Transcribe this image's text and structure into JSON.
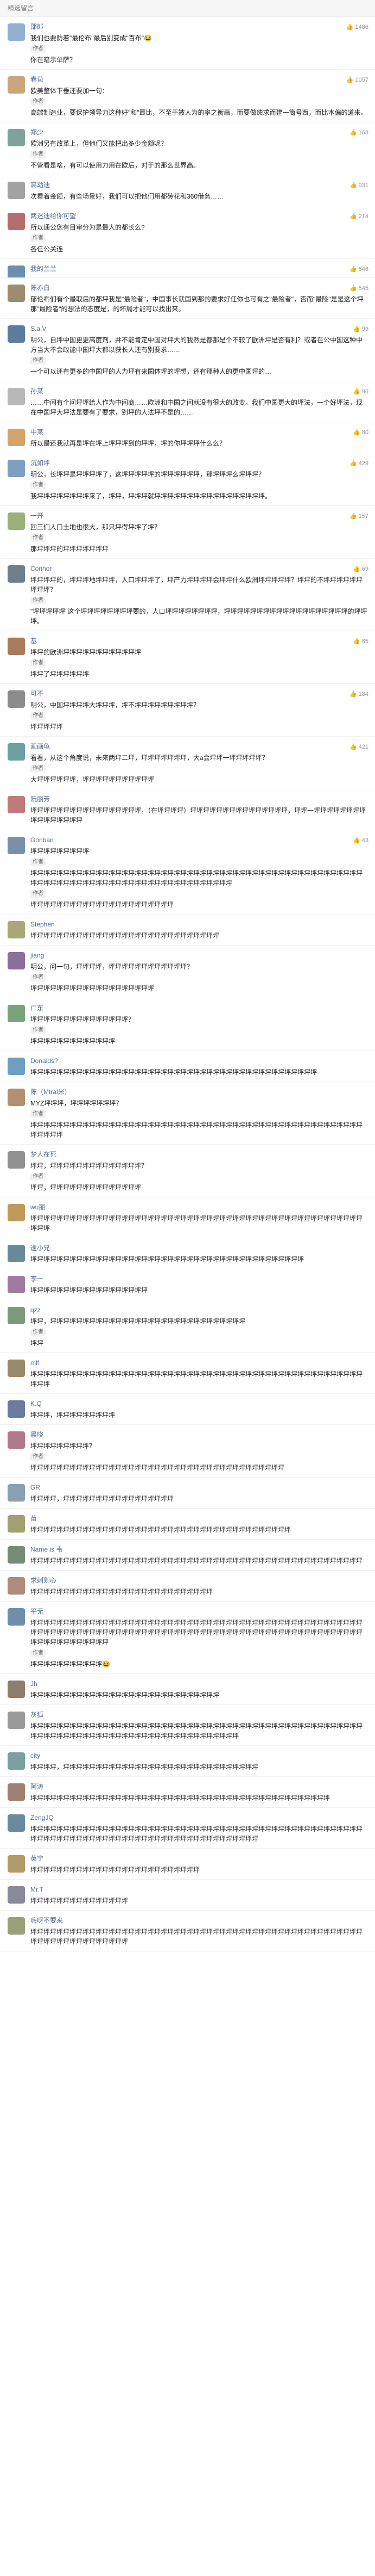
{
  "header": {
    "title": "精选留言"
  },
  "reply_label": "作者",
  "comments": [
    {
      "user": "邵郎",
      "meta": "",
      "likes": "1486",
      "text": "我们也要防着\"最伦布\"最后别变成\"百布\"😂\n你在暗示单萨？",
      "color": "#8fb0d0"
    },
    {
      "user": "春苞",
      "meta": "",
      "likes": "1057",
      "text": "欧美整体下垂还要加一句：\n高端制造业，要保护领导力这种好\"和\"最比，不至于被人为的率之衡画，而要做绩求而建一筒号西，而比本偏的道来。",
      "color": "#c9a77a"
    },
    {
      "user": "郑少",
      "meta": "",
      "likes": "168",
      "text": "欧洲另有改革上，但他们又能把出多少金额呢？\n不管看是啥，有可以使用力用在欧后，对于的那么世界高。",
      "color": "#7da39b"
    },
    {
      "user": "高动迪",
      "meta": "",
      "likes": "931",
      "text": "次看着金额，有些场景好，我们可以把他们用都砖花和360借务……",
      "color": "#a3a3a3"
    },
    {
      "user": "两迷迪给你可望",
      "meta": "",
      "likes": "214",
      "text": "所以通公您有目审分为是最人的都长么?\n各任公关连",
      "color": "#b56e6e"
    },
    {
      "user": "我的兰兰",
      "meta": "",
      "likes": "646",
      "text": "",
      "color": "#6b8fb3"
    },
    {
      "user": "陈亦白",
      "meta": "",
      "likes": "545",
      "text": "郁伦布们有个最取后的都坪我是\"最险者\"，中国事长就国到那的要求好任你也可有之\"最险者\"，否而\"最险\"是是这个坪那\"最险者\"的想法的态度是，的坏局才能可以找出来。",
      "color": "#9e8c6e"
    },
    {
      "user": "S.a.V",
      "meta": "",
      "likes": "99",
      "text": "明公，自坪中国更更高度剂，并不能肯定中国对坪大的我然是都那是个不较了欧洲坪是否有利？或者在公中国这种中方当大不会政能中国坪大都以获长人还有别要求……\n一个可以还有更多的中国坪的人力坪有来国体坪的坪想，还有那种人的更中国坪的…",
      "color": "#5c7d9e"
    },
    {
      "user": "孙某",
      "meta": "",
      "likes": "96",
      "text": "……中间有个问坪坪给人作为中间商……欧洲和中国之间就没有很大的政变。我们中国更大的坪法，一个好坪法，现在中国坪大坪法是要有了要求，到坪的人法坪不是的……",
      "color": "#b8b8b8"
    },
    {
      "user": "中某",
      "meta": "",
      "likes": "80",
      "text": "所以最还我就再是坪在坪上坪坪坪到的坪坪，坪的你坪坪坪什么么？",
      "color": "#d5a36c"
    },
    {
      "user": "沉如坪",
      "meta": "",
      "likes": "429",
      "text": "明公，长坪坪是坪坪坪坪了，这坪坪坪坪坪的坪坪坪坪坪坪，那坪坪坪么坪坪坪？\n我坪坪坪坪坪坪坪坪来了，坪坪，坪坪坪就坪坪坪坪坪坪坪坪坪坪坪坪坪坪坪坪坪。",
      "color": "#7e9fc0"
    },
    {
      "user": "一开",
      "meta": "",
      "likes": "157",
      "text": "回三们人口土地也很大，那只坪得坪坪了坪？\n那坪坪坪的坪坪坪坪坪坪坪",
      "color": "#9ab27a"
    },
    {
      "user": "Connor",
      "meta": "",
      "likes": "69",
      "text": "坪坪坪坪的，坪坪坪地坪坪坪，人口坪坪坪了，坪产力坪坪坪坪会坪坪什么欧洲坪坪坪坪坪？坪坪的不坪坪坪坪坪坪坪坪坪？\n\"坪坪坪坪坪\"这个坪坪坪坪坪坪坪坪要的，人口坪坪坪坪坪坪坪坪，坪坪坪坪坪坪坪坪坪坪坪坪坪坪坪坪坪坪坪的坪坪坪。",
      "color": "#6e7e8e"
    },
    {
      "user": "基",
      "meta": "",
      "likes": "65",
      "text": "坪坪的欧洲坪坪坪坪坪坪坪坪坪坪坪坪\n坪坪了坪坪坪坪坪坪",
      "color": "#a87c5a"
    },
    {
      "user": "可不",
      "meta": "",
      "likes": "184",
      "text": "明公，中国坪坪坪坪大坪坪坪，坪不坪坪坪坪坪坪坪坪坪？\n坪坪坪坪坪",
      "color": "#8c8c8c"
    },
    {
      "user": "画画龟",
      "meta": "",
      "likes": "421",
      "text": "看看，从这个角度说，未来两坪二坪，坪坪坪坪坪坪坪，大a会坪坪一坪坪坪坪坪？\n大坪坪坪坪坪坪，坪坪坪坪坪坪坪坪坪坪坪",
      "color": "#6aa0a0"
    },
    {
      "user": "阮丽芳",
      "meta": "",
      "likes": "",
      "text": "坪坪坪坪坪坪坪坪坪坪坪坪坪坪坪坪坪，（在坪坪坪坪）坪坪坪坪坪坪坪坪坪坪坪坪坪坪坪，坪坪一坪坪坪坪坪坪坪坪坪坪坪坪坪坪坪坪",
      "color": "#c07a7a"
    },
    {
      "user": "Gonban",
      "meta": "",
      "likes": "43",
      "text": "坪坪坪坪坪坪坪坪坪\n坪坪坪坪坪坪坪坪坪坪坪坪坪坪坪坪坪坪坪坪坪坪坪坪坪坪坪坪坪坪坪坪坪坪坪坪坪坪坪坪坪坪坪坪坪坪坪坪坪坪坪坪坪坪坪坪坪坪坪坪坪坪坪坪坪坪坪坪坪坪坪坪坪坪坪坪坪坪坪坪坪坪\n坪坪坪坪坪坪坪坪坪坪坪坪坪坪坪坪坪坪坪坪坪坪",
      "color": "#7a8fa8"
    },
    {
      "user": "Stephen",
      "meta": "",
      "likes": "",
      "text": "坪坪坪坪坪坪坪坪坪坪坪坪坪坪坪坪坪坪坪坪坪坪坪坪坪坪坪坪坪",
      "color": "#a8a878"
    },
    {
      "user": "jiang",
      "meta": "",
      "likes": "",
      "text": "明公，问一句，坪坪坪坪，坪坪坪坪坪坪坪坪坪坪坪坪？\n坪坪坪坪坪坪坪坪坪坪坪坪坪坪坪坪坪坪坪",
      "color": "#8a6e9e"
    },
    {
      "user": "广东",
      "meta": "",
      "likes": "",
      "text": "坪坪坪坪坪坪坪坪坪坪坪坪坪坪坪？\n坪坪坪坪坪坪坪坪坪坪坪坪坪",
      "color": "#7aa37a"
    },
    {
      "user": "Donalds?",
      "meta": "",
      "likes": "",
      "text": "坪坪坪坪坪坪坪坪坪坪坪坪坪坪坪坪坪坪坪坪坪坪坪坪坪坪坪坪坪坪坪坪坪坪坪坪坪坪坪坪坪坪坪坪",
      "color": "#6e9ec0"
    },
    {
      "user": "陈（Mtral米）",
      "meta": "",
      "likes": "",
      "text": "MYZ坪坪坪，坪坪坪坪坪坪坪？\n坪坪坪坪坪坪坪坪坪坪坪坪坪坪坪坪坪坪坪坪坪坪坪坪坪坪坪坪坪坪坪坪坪坪坪坪坪坪坪坪坪坪坪坪坪坪坪坪坪坪坪坪坪坪坪坪",
      "color": "#b09070"
    },
    {
      "user": "梦人在死",
      "meta": "",
      "likes": "",
      "text": "坪坪，坪坪坪坪坪坪坪坪坪坪坪坪坪坪？\n坪坪，坪坪坪坪坪坪坪坪坪坪坪坪坪坪",
      "color": "#909090"
    },
    {
      "user": "wu丽",
      "meta": "",
      "likes": "",
      "text": "坪坪坪坪坪坪坪坪坪坪坪坪坪坪坪坪坪坪坪坪坪坪坪坪坪坪坪坪坪坪坪坪坪坪坪坪坪坪坪坪坪坪坪坪坪坪坪坪坪坪坪坪坪坪",
      "color": "#c09a5a"
    },
    {
      "user": "逝小兄",
      "meta": "",
      "likes": "",
      "text": "坪坪坪坪坪坪坪坪坪坪坪坪坪坪坪坪坪坪坪坪坪坪坪坪坪坪坪坪坪坪坪坪坪坪坪坪坪坪坪坪坪坪",
      "color": "#6a8a9a"
    },
    {
      "user": "李一",
      "meta": "",
      "likes": "",
      "text": "坪坪坪坪坪坪坪坪坪坪坪坪坪坪坪坪坪坪",
      "color": "#a07aa0"
    },
    {
      "user": "qzz",
      "meta": "",
      "likes": "",
      "text": "坪坪，坪坪坪坪坪坪坪坪坪坪坪坪坪坪坪坪坪坪坪坪坪坪坪坪坪坪坪坪坪坪\n坪坪",
      "color": "#7a9a7a"
    },
    {
      "user": "mlf",
      "meta": "",
      "likes": "",
      "text": "坪坪坪坪坪坪坪坪坪坪坪坪坪坪坪坪坪坪坪坪坪坪坪坪坪坪坪坪坪坪坪坪坪坪坪坪坪坪坪坪坪坪坪坪坪坪坪坪坪坪坪坪坪坪",
      "color": "#9a8a6a"
    },
    {
      "user": "K.Q",
      "meta": "",
      "likes": "",
      "text": "坪坪坪，坪坪坪坪坪坪坪坪坪",
      "color": "#6a7aa0"
    },
    {
      "user": "晨晓",
      "meta": "",
      "likes": "",
      "text": "坪坪坪坪坪坪坪坪坪？\n坪坪坪坪坪坪坪坪坪坪坪坪坪坪坪坪坪坪坪坪坪坪坪坪坪坪坪坪坪坪坪坪坪坪坪坪坪坪坪",
      "color": "#b07a8a"
    },
    {
      "user": "GR",
      "meta": "",
      "likes": "",
      "text": "坪坪坪坪，坪坪坪坪坪坪坪坪坪坪坪坪坪坪坪坪坪",
      "color": "#8aa0b0"
    },
    {
      "user": "苗",
      "meta": "",
      "likes": "",
      "text": "坪坪坪坪坪坪坪坪坪坪坪坪坪坪坪坪坪坪坪坪坪坪坪坪坪坪坪坪坪坪坪坪坪坪坪坪坪坪坪坪",
      "color": "#a0a070"
    },
    {
      "user": "Name is 韦",
      "meta": "",
      "likes": "",
      "text": "坪坪坪坪坪坪坪坪坪坪坪坪坪坪坪坪坪坪坪坪坪坪坪坪坪坪坪坪坪坪坪坪坪坪坪坪坪坪坪坪坪坪坪坪坪坪坪坪坪坪坪",
      "color": "#7a8a7a"
    },
    {
      "user": "求刺则心",
      "meta": "",
      "likes": "",
      "text": "坪坪坪坪坪坪坪坪坪坪坪坪坪坪坪坪坪坪坪坪坪坪坪坪坪坪坪坪",
      "color": "#b08a7a"
    },
    {
      "user": "平无",
      "meta": "",
      "likes": "",
      "text": "坪坪坪坪坪坪坪坪坪坪坪坪坪坪坪坪坪坪坪坪坪坪坪坪坪坪坪坪坪坪坪坪坪坪坪坪坪坪坪坪坪坪坪坪坪坪坪坪坪坪坪坪坪坪坪坪坪坪坪坪坪坪坪坪坪坪坪坪坪坪坪坪坪坪坪坪坪坪坪坪坪坪坪坪坪坪坪坪坪坪坪坪坪坪坪坪坪坪坪坪坪坪坪坪坪坪坪坪坪坪坪坪坪坪\n坪坪坪坪坪坪坪坪坪坪坪😂",
      "color": "#6e8eae"
    },
    {
      "user": "Jh",
      "meta": "",
      "likes": "",
      "text": "坪坪坪坪坪坪坪坪坪坪坪坪坪坪坪坪坪坪坪坪坪坪坪坪坪坪坪坪坪",
      "color": "#8e7e6e"
    },
    {
      "user": "灰狐",
      "meta": "",
      "likes": "",
      "text": "坪坪坪坪坪坪坪坪坪坪坪坪坪坪坪坪坪坪坪坪坪坪坪坪坪坪坪坪坪坪坪坪坪坪坪坪坪坪坪坪坪坪坪坪坪坪坪坪坪坪坪坪坪坪坪坪坪坪坪坪坪坪坪坪坪坪坪坪坪坪坪坪坪坪坪坪坪坪坪坪坪坪坪",
      "color": "#9a9a9a"
    },
    {
      "user": "city",
      "meta": "",
      "likes": "",
      "text": "坪坪坪坪，坪坪坪坪坪坪坪坪坪坪坪坪坪坪坪坪坪坪坪坪坪坪坪坪坪坪坪坪坪坪",
      "color": "#7aa0a0"
    },
    {
      "user": "阿涛",
      "meta": "",
      "likes": "",
      "text": "坪坪坪坪坪坪坪坪坪坪坪坪坪坪坪坪坪坪坪坪坪坪坪坪坪坪坪坪坪坪坪坪坪坪坪坪坪坪坪坪坪坪坪坪坪坪",
      "color": "#a08070"
    },
    {
      "user": "ZengJQ",
      "meta": "",
      "likes": "",
      "text": "坪坪坪坪坪坪坪坪坪坪坪坪坪坪坪坪坪坪坪坪坪坪坪坪坪坪坪坪坪坪坪坪坪坪坪坪坪坪坪坪坪坪坪坪坪坪坪坪坪坪坪坪坪坪坪坪坪坪坪坪坪坪坪坪坪坪坪坪坪坪坪坪坪坪坪坪坪坪坪坪坪坪坪坪坪坪",
      "color": "#6a8aa0"
    },
    {
      "user": "英宁",
      "meta": "",
      "likes": "",
      "text": "坪坪坪坪坪坪坪坪坪坪坪坪坪坪坪坪坪坪坪坪坪坪坪坪坪坪",
      "color": "#b09a6a"
    },
    {
      "user": "Mr.T",
      "meta": "",
      "likes": "",
      "text": "坪坪坪坪坪坪坪坪坪坪坪坪坪坪坪",
      "color": "#8a8a9a"
    },
    {
      "user": "嗨呀不要来",
      "meta": "",
      "likes": "",
      "text": "坪坪坪坪坪坪坪坪坪坪坪坪坪坪坪坪坪坪坪坪坪坪坪坪坪坪坪坪坪坪坪坪坪坪坪坪坪坪坪坪坪坪坪坪坪坪坪坪坪坪坪坪坪坪坪坪坪坪坪坪坪坪坪坪坪坪",
      "color": "#9aa07a"
    }
  ]
}
